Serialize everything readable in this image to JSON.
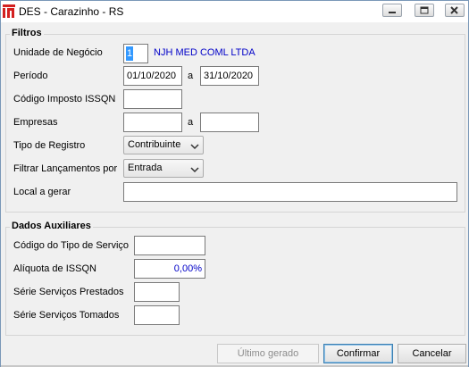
{
  "window": {
    "title": "DES - Carazinho - RS"
  },
  "filtros": {
    "group_title": "Filtros",
    "unidade_label": "Unidade de Negócio",
    "unidade_code": "1",
    "unidade_name": "NJH MED COML LTDA",
    "periodo_label": "Período",
    "periodo_from": "01/10/2020",
    "periodo_sep": "a",
    "periodo_to": "31/10/2020",
    "codigo_imposto_label": "Código Imposto ISSQN",
    "codigo_imposto_value": "",
    "empresas_label": "Empresas",
    "empresas_from": "",
    "empresas_sep": "a",
    "empresas_to": "",
    "tipo_registro_label": "Tipo de Registro",
    "tipo_registro_value": "Contribuinte",
    "filtrar_label": "Filtrar Lançamentos por",
    "filtrar_value": "Entrada",
    "local_label": "Local a gerar",
    "local_value": ""
  },
  "auxiliares": {
    "group_title": "Dados Auxiliares",
    "codigo_servico_label": "Código do Tipo de Serviço",
    "codigo_servico_value": "",
    "aliquota_label": "Alíquota de ISSQN",
    "aliquota_value": "0,00%",
    "serie_prestados_label": "Série Serviços Prestados",
    "serie_prestados_value": "",
    "serie_tomados_label": "Série Serviços Tomados",
    "serie_tomados_value": ""
  },
  "buttons": {
    "ultimo": "Último gerado",
    "confirmar": "Confirmar",
    "cancelar": "Cancelar"
  }
}
